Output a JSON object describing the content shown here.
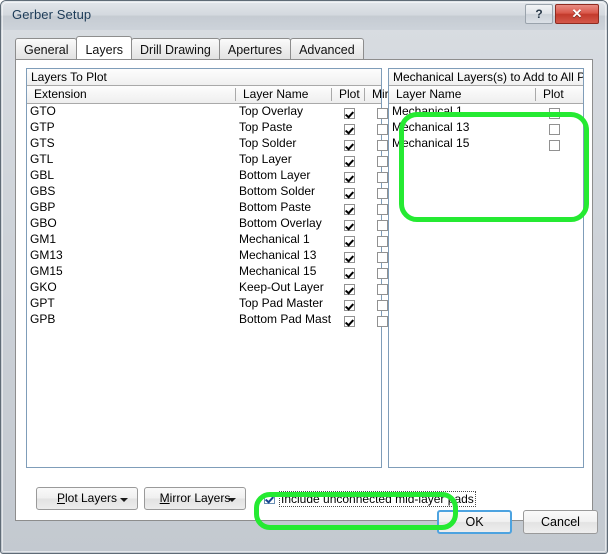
{
  "window": {
    "title": "Gerber Setup",
    "help_label": "?",
    "close_label": "✕"
  },
  "tabs": [
    {
      "label": "General",
      "active": false
    },
    {
      "label": "Layers",
      "active": true
    },
    {
      "label": "Drill Drawing",
      "active": false
    },
    {
      "label": "Apertures",
      "active": false
    },
    {
      "label": "Advanced",
      "active": false
    }
  ],
  "left_grid": {
    "caption": "Layers To Plot",
    "columns": {
      "extension": "Extension",
      "layer_name": "Layer Name",
      "plot": "Plot",
      "mirror": "Mir..."
    },
    "rows": [
      {
        "extension": "GTO",
        "layer_name": "Top Overlay",
        "plot": true,
        "mirror": false
      },
      {
        "extension": "GTP",
        "layer_name": "Top Paste",
        "plot": true,
        "mirror": false
      },
      {
        "extension": "GTS",
        "layer_name": "Top Solder",
        "plot": true,
        "mirror": false
      },
      {
        "extension": "GTL",
        "layer_name": "Top Layer",
        "plot": true,
        "mirror": false
      },
      {
        "extension": "GBL",
        "layer_name": "Bottom Layer",
        "plot": true,
        "mirror": false
      },
      {
        "extension": "GBS",
        "layer_name": "Bottom Solder",
        "plot": true,
        "mirror": false
      },
      {
        "extension": "GBP",
        "layer_name": "Bottom Paste",
        "plot": true,
        "mirror": false
      },
      {
        "extension": "GBO",
        "layer_name": "Bottom Overlay",
        "plot": true,
        "mirror": false
      },
      {
        "extension": "GM1",
        "layer_name": "Mechanical 1",
        "plot": true,
        "mirror": false
      },
      {
        "extension": "GM13",
        "layer_name": "Mechanical 13",
        "plot": true,
        "mirror": false
      },
      {
        "extension": "GM15",
        "layer_name": "Mechanical 15",
        "plot": true,
        "mirror": false
      },
      {
        "extension": "GKO",
        "layer_name": "Keep-Out Layer",
        "plot": true,
        "mirror": false
      },
      {
        "extension": "GPT",
        "layer_name": "Top Pad Master",
        "plot": true,
        "mirror": false
      },
      {
        "extension": "GPB",
        "layer_name": "Bottom Pad Mast‹",
        "plot": true,
        "mirror": false
      }
    ]
  },
  "right_grid": {
    "caption": "Mechanical Layers(s) to Add to All Plot",
    "columns": {
      "layer_name": "Layer Name",
      "plot": "Plot"
    },
    "rows": [
      {
        "layer_name": "Mechanical 1",
        "plot": false
      },
      {
        "layer_name": "Mechanical 13",
        "plot": false
      },
      {
        "layer_name": "Mechanical 15",
        "plot": false
      }
    ]
  },
  "controls": {
    "plot_layers_button": "Plot Layers",
    "plot_layers_accel": "P",
    "mirror_layers_button": "Mirror Layers",
    "mirror_layers_accel": "M",
    "include_midlayer_pads": {
      "label": "Include unconnected mid-layer pads",
      "checked": true
    }
  },
  "footer": {
    "ok_label": "OK",
    "cancel_label": "Cancel"
  },
  "annotations": {
    "color": "#25ea32",
    "highlight_right_grid": true,
    "highlight_midlayer_checkbox": true
  }
}
